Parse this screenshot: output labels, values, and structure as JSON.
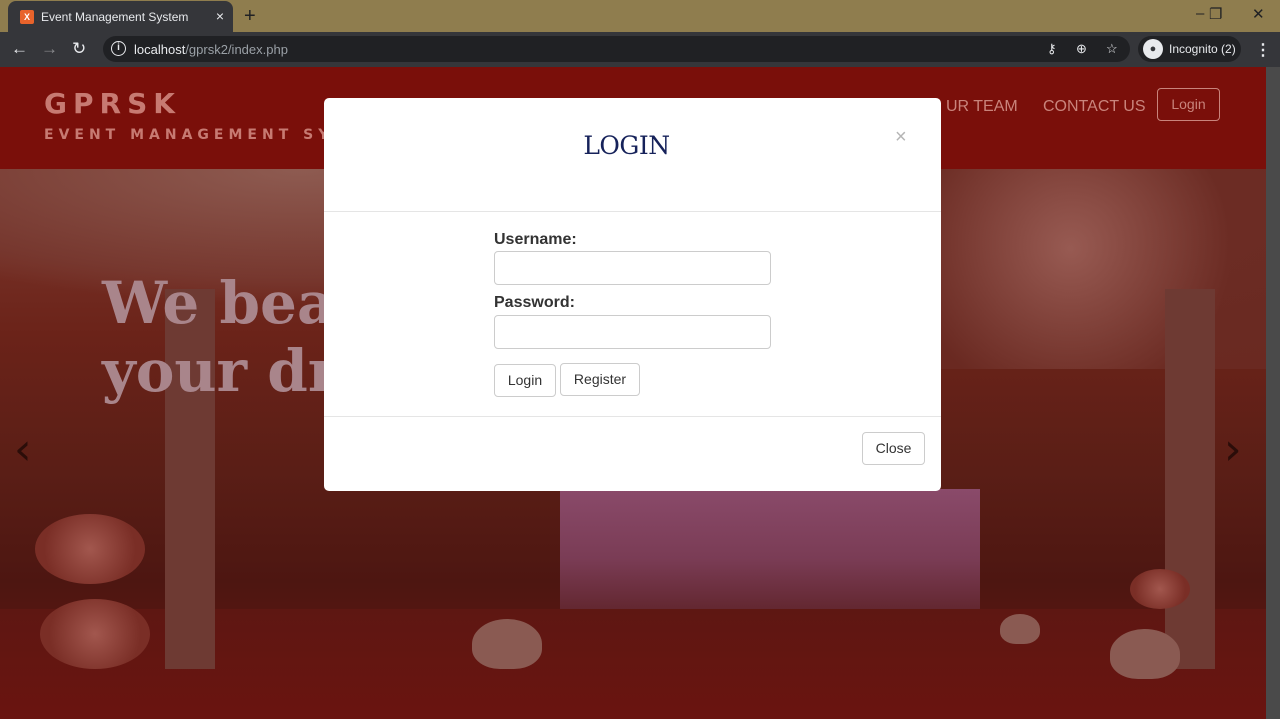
{
  "browser": {
    "tab_title": "Event Management System",
    "tab_close": "×",
    "new_tab": "+",
    "url_host": "localhost",
    "url_path": "/gprsk2/index.php",
    "profile_label": "Incognito (2)",
    "window_controls": {
      "minimize": "–",
      "restore": "❐",
      "close": "✕"
    }
  },
  "site": {
    "brand": "GPRSK",
    "tagline": "EVENT MANAGEMENT SYS",
    "nav": {
      "our_team": "UR TEAM",
      "contact_us": "CONTACT US",
      "login": "Login"
    },
    "hero_line1": "We beau",
    "hero_line2": "your dre",
    "carousel_prev": "‹",
    "carousel_next": "›"
  },
  "modal": {
    "title": "LOGIN",
    "close_x": "×",
    "username_label": "Username:",
    "username_value": "",
    "password_label": "Password:",
    "password_value": "",
    "login_button": "Login",
    "register_button": "Register",
    "close_button": "Close"
  },
  "colors": {
    "header_red": "#7a0f0a",
    "modal_title": "#16225a"
  }
}
